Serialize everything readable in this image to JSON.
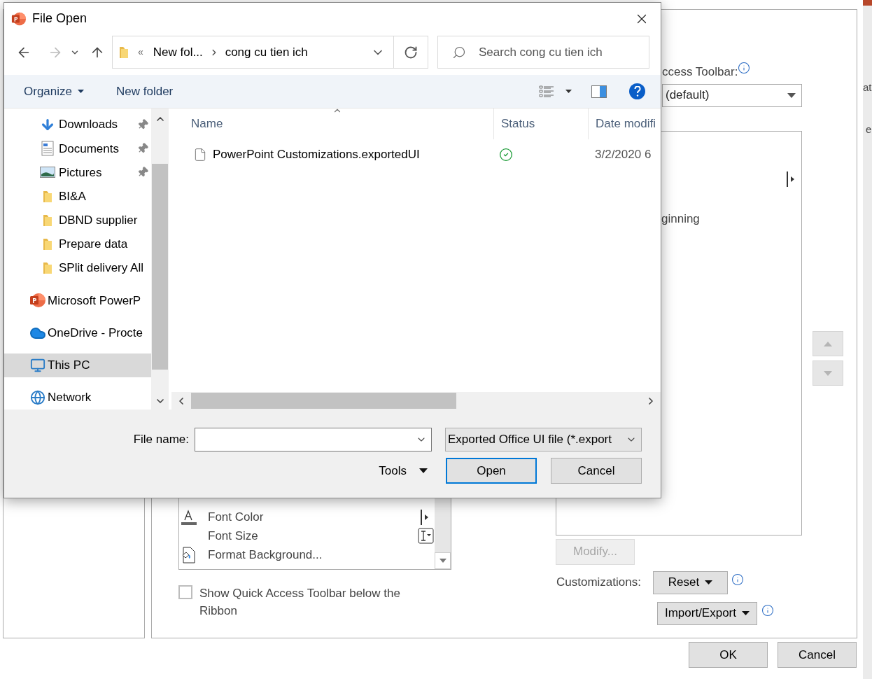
{
  "file_dialog": {
    "title": "File Open",
    "address": {
      "overflow_mark": "«",
      "path": [
        "New fol...",
        "cong cu tien ich"
      ]
    },
    "search": {
      "placeholder": "Search cong cu tien ich"
    },
    "toolbar": {
      "organize": "Organize",
      "new_folder": "New folder"
    },
    "nav_items": [
      {
        "label": "Downloads",
        "kind": "downloads",
        "pinned": true,
        "selected": false
      },
      {
        "label": "Documents",
        "kind": "documents",
        "pinned": true,
        "selected": false
      },
      {
        "label": "Pictures",
        "kind": "pictures",
        "pinned": true,
        "selected": false
      },
      {
        "label": "BI&A",
        "kind": "folder",
        "pinned": false,
        "selected": false
      },
      {
        "label": "DBND supplier",
        "kind": "folder",
        "pinned": false,
        "selected": false
      },
      {
        "label": "Prepare data",
        "kind": "folder",
        "pinned": false,
        "selected": false
      },
      {
        "label": "SPlit delivery All",
        "kind": "folder",
        "pinned": false,
        "selected": false
      },
      {
        "label": "Microsoft PowerP",
        "kind": "app",
        "pinned": false,
        "selected": false
      },
      {
        "label": "OneDrive - Procte",
        "kind": "cloud",
        "pinned": false,
        "selected": false
      },
      {
        "label": "This PC",
        "kind": "pc",
        "pinned": false,
        "selected": true
      },
      {
        "label": "Network",
        "kind": "network",
        "pinned": false,
        "selected": false
      }
    ],
    "columns": [
      {
        "label": "Name",
        "sorted": true
      },
      {
        "label": "Status",
        "sorted": false
      },
      {
        "label": "Date modifi",
        "sorted": false
      }
    ],
    "rows": [
      {
        "name": "PowerPoint Customizations.exportedUI",
        "synced": true,
        "date": "3/2/2020 6"
      }
    ],
    "file_name": {
      "label": "File name:"
    },
    "filter": "Exported Office UI file (*.export",
    "tools": "Tools",
    "buttons": [
      {
        "label": "Open",
        "default": true
      },
      {
        "label": "Cancel",
        "default": false
      }
    ]
  },
  "options": {
    "qat_label": "ccess Toolbar:",
    "qat_select": "(default)",
    "list_text": "ginning",
    "commands": [
      {
        "label": "Font Color",
        "kind": "font-color"
      },
      {
        "label": "Font Size",
        "kind": "font-size"
      },
      {
        "label": "Format Background...",
        "kind": "format-background"
      }
    ],
    "show_below": {
      "label": "Show Quick Access Toolbar below the Ribbon",
      "checked": false
    },
    "modify": {
      "label": "Modify...",
      "disabled": true
    },
    "customizations": {
      "label": "Customizations:",
      "reset": "Reset",
      "import_export": "Import/Export"
    },
    "buttons": [
      "OK",
      "Cancel"
    ],
    "edge_texts": [
      "at",
      "e"
    ]
  }
}
